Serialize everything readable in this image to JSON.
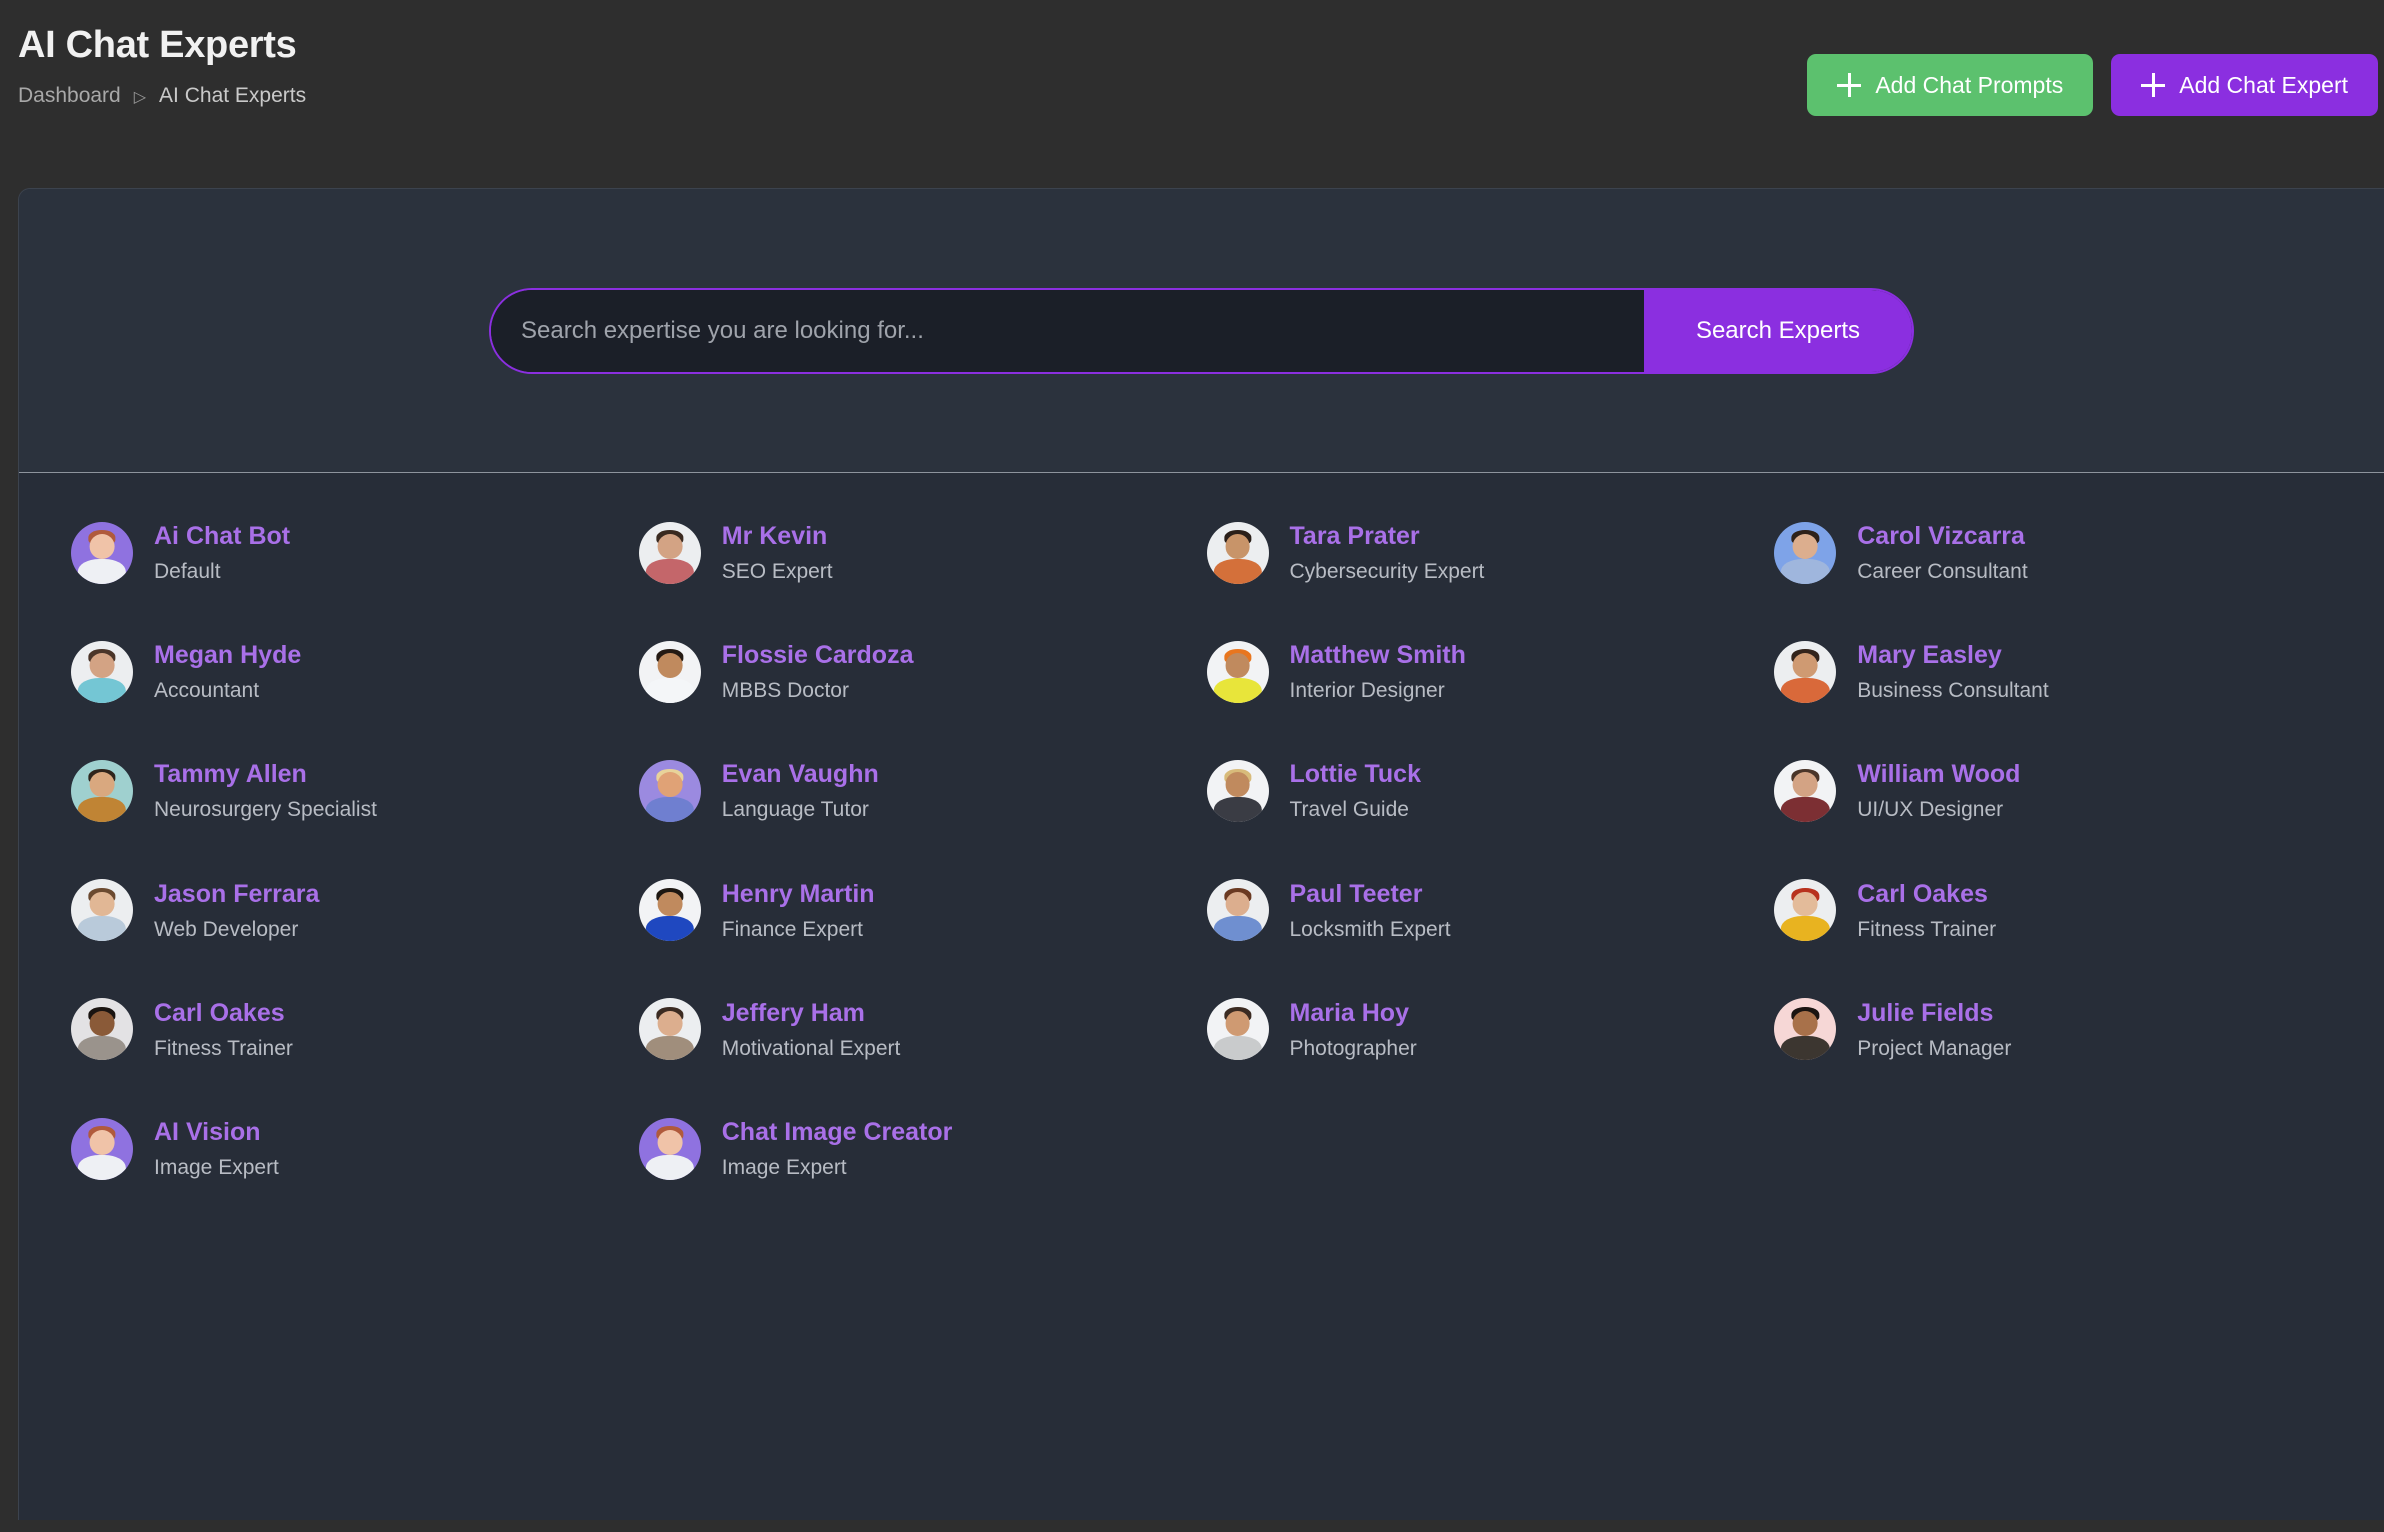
{
  "header": {
    "title": "AI Chat Experts",
    "breadcrumb": {
      "root": "Dashboard",
      "separator": "▷",
      "current": "AI Chat Experts"
    },
    "buttons": {
      "add_prompts": "Add Chat Prompts",
      "add_expert": "Add Chat Expert"
    },
    "colors": {
      "green": "#5cc16e",
      "purple": "#8b2fe0"
    }
  },
  "search": {
    "placeholder": "Search expertise you are looking for...",
    "value": "",
    "button_label": "Search Experts"
  },
  "experts": [
    {
      "name": "Ai Chat Bot",
      "role": "Default",
      "avatar_kind": "illustration",
      "bg": "#8f72e0",
      "skin": "#f0c3a8",
      "hair": "#b05a3c",
      "body": "#eef0f4"
    },
    {
      "name": "Mr Kevin",
      "role": "SEO Expert",
      "avatar_kind": "photo",
      "bg": "#eceef0",
      "skin": "#d3a384",
      "hair": "#3a2a20",
      "body": "#c4666a"
    },
    {
      "name": "Tara Prater",
      "role": "Cybersecurity Expert",
      "avatar_kind": "photo",
      "bg": "#eceef0",
      "skin": "#c89469",
      "hair": "#2a1f19",
      "body": "#d4703a"
    },
    {
      "name": "Carol Vizcarra",
      "role": "Career Consultant",
      "avatar_kind": "photo",
      "bg": "#7ea3e8",
      "skin": "#dcae8e",
      "hair": "#2e2119",
      "body": "#9fb6dd"
    },
    {
      "name": "Megan Hyde",
      "role": "Accountant",
      "avatar_kind": "photo",
      "bg": "#eceef0",
      "skin": "#d3a384",
      "hair": "#4a3529",
      "body": "#74c6d4"
    },
    {
      "name": "Flossie Cardoza",
      "role": "MBBS Doctor",
      "avatar_kind": "photo",
      "bg": "#f2f3f5",
      "skin": "#c08a5e",
      "hair": "#241a14",
      "body": "#f4f6f8"
    },
    {
      "name": "Matthew Smith",
      "role": "Interior Designer",
      "avatar_kind": "photo",
      "bg": "#f2f3f5",
      "skin": "#c08a5e",
      "hair": "#e8761f",
      "body": "#e8e53a"
    },
    {
      "name": "Mary Easley",
      "role": "Business Consultant",
      "avatar_kind": "photo",
      "bg": "#eceef0",
      "skin": "#cf9a72",
      "hair": "#33241b",
      "body": "#d9693a"
    },
    {
      "name": "Tammy Allen",
      "role": "Neurosurgery Specialist",
      "avatar_kind": "photo",
      "bg": "#9fd0cf",
      "skin": "#d9a87f",
      "hair": "#2f241b",
      "body": "#c08434"
    },
    {
      "name": "Evan Vaughn",
      "role": "Language Tutor",
      "avatar_kind": "illustration",
      "bg": "#9b8ae0",
      "skin": "#e0a276",
      "hair": "#e8d39a",
      "body": "#6f7fd0"
    },
    {
      "name": "Lottie Tuck",
      "role": "Travel Guide",
      "avatar_kind": "photo",
      "bg": "#f2f3f5",
      "skin": "#c08a5e",
      "hair": "#d8bb7a",
      "body": "#3a3c44"
    },
    {
      "name": "William Wood",
      "role": "UI/UX Designer",
      "avatar_kind": "photo",
      "bg": "#f2f3f5",
      "skin": "#d3a384",
      "hair": "#4a3529",
      "body": "#7c2f33"
    },
    {
      "name": "Jason Ferrara",
      "role": "Web Developer",
      "avatar_kind": "photo",
      "bg": "#eceef0",
      "skin": "#e1b795",
      "hair": "#6b4a30",
      "body": "#b9cada"
    },
    {
      "name": "Henry Martin",
      "role": "Finance Expert",
      "avatar_kind": "photo",
      "bg": "#f2f3f5",
      "skin": "#c08a5e",
      "hair": "#1d1712",
      "body": "#1f48c0"
    },
    {
      "name": "Paul Teeter",
      "role": "Locksmith Expert",
      "avatar_kind": "photo",
      "bg": "#eceef0",
      "skin": "#dcae8e",
      "hair": "#6b3a22",
      "body": "#6f8fd0"
    },
    {
      "name": "Carl Oakes",
      "role": "Fitness Trainer",
      "avatar_kind": "photo",
      "bg": "#eceef0",
      "skin": "#e3bb9a",
      "hair": "#b8321e",
      "body": "#e8b320"
    },
    {
      "name": "Carl Oakes",
      "role": "Fitness Trainer",
      "avatar_kind": "photo",
      "bg": "#e3e2e4",
      "skin": "#8a5a38",
      "hair": "#1a1411",
      "body": "#9a938c"
    },
    {
      "name": "Jeffery Ham",
      "role": "Motivational Expert",
      "avatar_kind": "photo",
      "bg": "#eceef0",
      "skin": "#dcae8e",
      "hair": "#3b2b22",
      "body": "#a08e7c"
    },
    {
      "name": "Maria Hoy",
      "role": "Photographer",
      "avatar_kind": "photo",
      "bg": "#f2f3f5",
      "skin": "#cf9a72",
      "hair": "#3b2b22",
      "body": "#c9cbcc"
    },
    {
      "name": "Julie Fields",
      "role": "Project Manager",
      "avatar_kind": "photo",
      "bg": "#f6d7d6",
      "skin": "#a8714a",
      "hair": "#1a1411",
      "body": "#3c3630"
    },
    {
      "name": "AI Vision",
      "role": "Image Expert",
      "avatar_kind": "illustration",
      "bg": "#8f72e0",
      "skin": "#f0c3a8",
      "hair": "#b05a3c",
      "body": "#eef0f4"
    },
    {
      "name": "Chat Image Creator",
      "role": "Image Expert",
      "avatar_kind": "illustration",
      "bg": "#8f72e0",
      "skin": "#f0c3a8",
      "hair": "#b05a3c",
      "body": "#eef0f4"
    }
  ]
}
